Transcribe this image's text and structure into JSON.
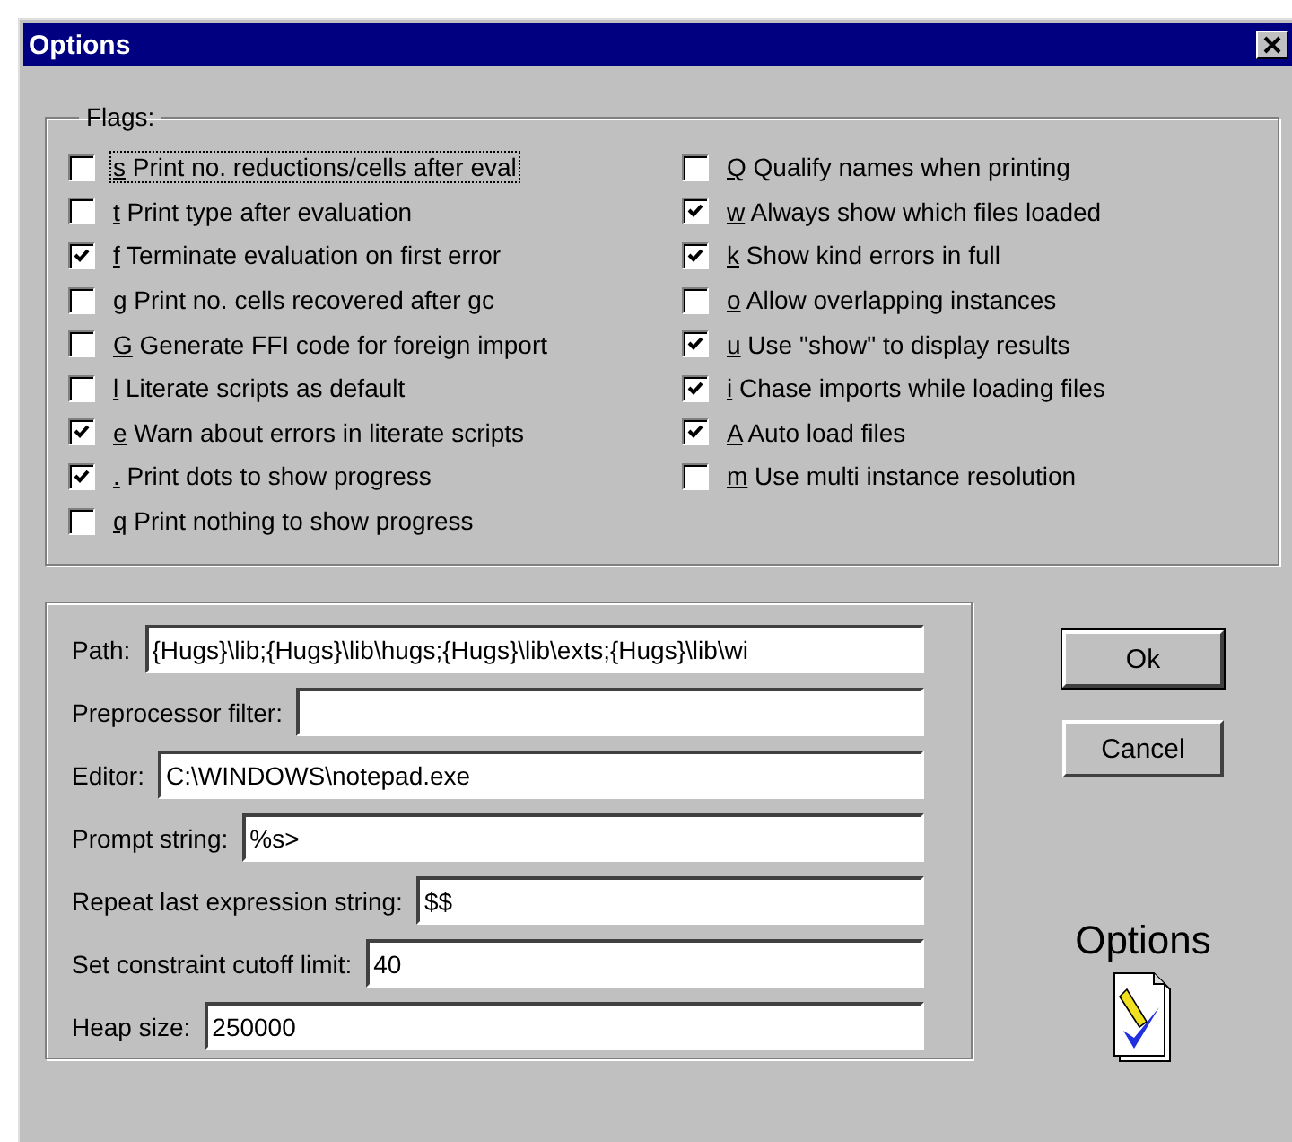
{
  "window": {
    "title": "Options"
  },
  "flags": {
    "title": "Flags:",
    "columns": [
      [
        {
          "key": "s",
          "label": "Print no. reductions/cells after eval",
          "checked": false,
          "focused": true
        },
        {
          "key": "t",
          "label": "Print type after evaluation",
          "checked": false,
          "focused": false
        },
        {
          "key": "f",
          "label": "Terminate evaluation on first error",
          "checked": true,
          "focused": false
        },
        {
          "key": "g",
          "label": "Print no. cells recovered after gc",
          "checked": false,
          "focused": false
        },
        {
          "key": "G",
          "label": "Generate FFI code for foreign import",
          "checked": false,
          "focused": false
        },
        {
          "key": "l",
          "label": "Literate scripts as default",
          "checked": false,
          "focused": false
        },
        {
          "key": "e",
          "label": "Warn about errors in literate scripts",
          "checked": true,
          "focused": false
        },
        {
          "key": ".",
          "label": "Print dots to show progress",
          "checked": true,
          "focused": false
        },
        {
          "key": "q",
          "label": "Print nothing to show progress",
          "checked": false,
          "focused": false
        }
      ],
      [
        {
          "key": "Q",
          "label": "Qualify names when printing",
          "checked": false,
          "focused": false
        },
        {
          "key": "w",
          "label": "Always show which files loaded",
          "checked": true,
          "focused": false
        },
        {
          "key": "k",
          "label": "Show kind errors in full",
          "checked": true,
          "focused": false
        },
        {
          "key": "o",
          "label": "Allow overlapping instances",
          "checked": false,
          "focused": false
        },
        {
          "key": "u",
          "label": "Use \"show\" to display results",
          "checked": true,
          "focused": false
        },
        {
          "key": "i",
          "label": "Chase imports while loading files",
          "checked": true,
          "focused": false
        },
        {
          "key": "A",
          "label": "Auto load files",
          "checked": true,
          "focused": false
        },
        {
          "key": "m",
          "label": "Use multi instance resolution",
          "checked": false,
          "focused": false
        }
      ]
    ]
  },
  "fields": [
    {
      "label": "Path:",
      "value": "{Hugs}\\lib;{Hugs}\\lib\\hugs;{Hugs}\\lib\\exts;{Hugs}\\lib\\wi"
    },
    {
      "label": "Preprocessor filter:"
    },
    {
      "label": "Editor:",
      "value": "C:\\WINDOWS\\notepad.exe"
    },
    {
      "label": "Prompt string:",
      "value": "%s>"
    },
    {
      "label": "Repeat last expression string:",
      "value": "$$"
    },
    {
      "label": "Set constraint cutoff limit:",
      "value": "40"
    },
    {
      "label": "Heap size:",
      "value": "250000"
    }
  ],
  "buttons": [
    {
      "label": "Ok",
      "default": true
    },
    {
      "label": "Cancel",
      "default": false
    }
  ],
  "side_caption": "Options"
}
